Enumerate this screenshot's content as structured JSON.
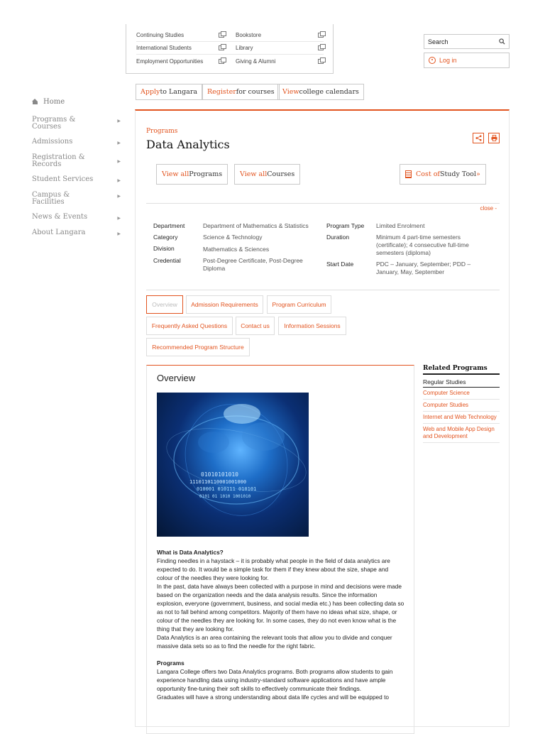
{
  "quick_links": [
    [
      "Continuing Studies",
      "Bookstore"
    ],
    [
      "International Students",
      "Library"
    ],
    [
      "Employment Opportunities",
      "Giving & Alumni"
    ]
  ],
  "search": {
    "label": "Search"
  },
  "login": {
    "label": "Log in"
  },
  "top_buttons": {
    "apply_a": "Apply",
    "apply_b": " to Langara",
    "register_a": "Register",
    "register_b": " for courses",
    "view_a": "View",
    "view_b": " college calendars"
  },
  "left_nav": {
    "home": "Home",
    "items": [
      "Programs & Courses",
      "Admissions",
      "Registration & Records",
      "Student Services",
      "Campus & Facilities",
      "News & Events",
      "About Langara"
    ]
  },
  "main": {
    "breadcrumb": "Programs",
    "title": "Data Analytics",
    "view_all_a": "View all",
    "view_programs": " Programs",
    "view_courses": " Courses",
    "cost_a": "Cost of",
    "cost_b": " Study Tool",
    "cost_c": " »",
    "close": "close -"
  },
  "program_info": {
    "department_label": "Department",
    "department_value": "Department of Mathematics & Statistics",
    "category_label": "Category",
    "category_value": "Science & Technology",
    "division_label": "Division",
    "division_value": "Mathematics & Sciences",
    "credential_label": "Credential",
    "credential_value": "Post-Degree Certificate, Post-Degree Diploma",
    "type_label": "Program Type",
    "type_value": "Limited Enrolment",
    "duration_label": "Duration",
    "duration_value": "Minimum 4 part-time semesters (certificate); 4 consecutive full-time semesters (diploma)",
    "start_label": "Start Date",
    "start_value": "PDC – January, September; PDD – January, May, September"
  },
  "tabs": {
    "overview": "Overview",
    "admission": "Admission Requirements",
    "curriculum": "Program Curriculum",
    "faq": "Frequently Asked Questions",
    "contact": "Contact us",
    "sessions": "Information Sessions",
    "structure": "Recommended Program Structure"
  },
  "overview": {
    "title": "Overview",
    "binary": [
      "01010101010",
      "1110110110001001000",
      "010001 010111 010101",
      "0101 01 1010 1001010"
    ],
    "q_title": "What is Data Analytics?",
    "p1": "Finding needles in a haystack – it is probably what people in the field of data analytics are expected to do. It would be a simple task for them if they knew about the size, shape and colour of the needles they were looking for.",
    "p2": "In the past, data have always been collected with a purpose in mind and decisions were made based on the organization needs and the data analysis results. Since the information explosion, everyone (government, business, and social media etc.) has been collecting data so as not to fall behind among competitors. Majority of them have no ideas what size, shape, or colour of the needles they are looking for. In some cases, they do not even know what is the thing that they are looking for.",
    "p3": "Data Analytics is an area containing the relevant tools that allow you to divide and conquer massive data sets so as to find the needle for the right fabric.",
    "programs_title": "Programs",
    "p4": "Langara College offers two Data Analytics programs. Both programs allow students to gain experience handling data using industry-standard software applications and have ample opportunity fine-tuning their soft skills to effectively communicate their findings.",
    "p5": "Graduates will have a strong understanding about data life cycles and will be equipped to"
  },
  "related": {
    "title": "Related Programs",
    "subtitle": "Regular Studies",
    "items": [
      "Computer Science",
      "Computer Studies",
      "Internet and Web Technology",
      "Web and Mobile App Design and Development"
    ]
  },
  "colors": {
    "accent": "#e2531e"
  }
}
